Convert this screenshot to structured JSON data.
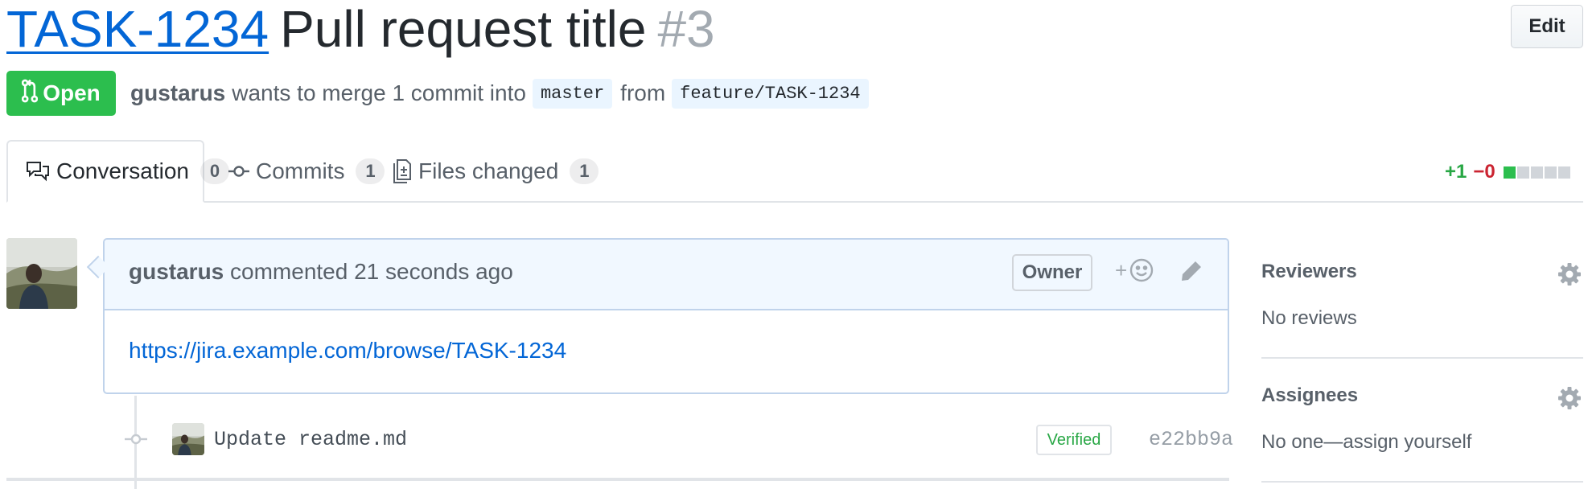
{
  "header": {
    "issue_key": "TASK-1234",
    "title": "Pull request title",
    "number": "#3",
    "edit_label": "Edit"
  },
  "status": {
    "state": "Open",
    "author": "gustarus",
    "merge_text": "wants to merge 1 commit into",
    "base_branch": "master",
    "from_text": "from",
    "head_branch": "feature/TASK-1234"
  },
  "tabs": [
    {
      "label": "Conversation",
      "count": "0",
      "icon": "comment-discussion-icon",
      "active": true
    },
    {
      "label": "Commits",
      "count": "1",
      "icon": "git-commit-icon",
      "active": false
    },
    {
      "label": "Files changed",
      "count": "1",
      "icon": "file-diff-icon",
      "active": false
    }
  ],
  "diffstat": {
    "additions": "+1",
    "deletions": "−0",
    "blocks": [
      "added",
      "neutral",
      "neutral",
      "neutral",
      "neutral"
    ],
    "colors": {
      "added": "#2cbe4e",
      "neutral": "#d1d5da"
    }
  },
  "comment": {
    "author": "gustarus",
    "action": "commented 21 seconds ago",
    "badge": "Owner",
    "reaction_plus": "+",
    "body_link": "https://jira.example.com/browse/TASK-1234"
  },
  "commit": {
    "message": "Update readme.md",
    "verified_label": "Verified",
    "sha": "e22bb9a"
  },
  "sidebar": {
    "reviewers": {
      "heading": "Reviewers",
      "value": "No reviews"
    },
    "assignees": {
      "heading": "Assignees",
      "value": "No one—assign yourself"
    }
  },
  "colors": {
    "link": "#0366d6",
    "open_green": "#2cbe4e",
    "deletion_red": "#cb2431",
    "comment_header_bg": "#f1f8ff",
    "comment_border": "#c0d3eb"
  }
}
